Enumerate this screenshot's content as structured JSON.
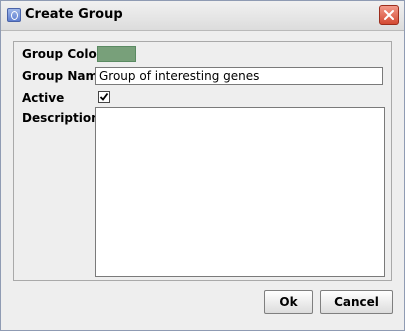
{
  "window": {
    "title": "Create Group"
  },
  "form": {
    "group_color": {
      "label": "Group Color",
      "value": "#78a07a"
    },
    "group_name": {
      "label": "Group Name",
      "value": "Group of interesting genes"
    },
    "active": {
      "label": "Active",
      "checked": true
    },
    "description": {
      "label": "Description",
      "value": ""
    }
  },
  "buttons": {
    "ok_label": "Ok",
    "cancel_label": "Cancel"
  },
  "icons": {
    "app": "app-icon",
    "close": "close-icon",
    "check": "checkmark-icon"
  }
}
